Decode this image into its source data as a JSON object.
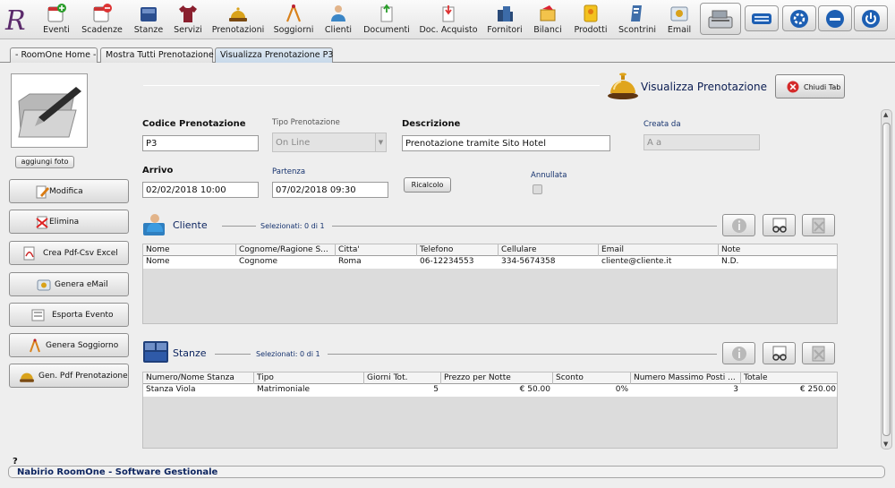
{
  "toolbar": {
    "items": [
      {
        "label": "Eventi",
        "icon": "eventi-add-icon"
      },
      {
        "label": "Scadenze",
        "icon": "scadenze-calendar-icon"
      },
      {
        "label": "Stanze",
        "icon": "stanze-bed-icon"
      },
      {
        "label": "Servizi",
        "icon": "servizi-shirt-icon"
      },
      {
        "label": "Prenotazioni",
        "icon": "prenotazioni-bell-icon"
      },
      {
        "label": "Soggiorni",
        "icon": "soggiorni-compass-icon"
      },
      {
        "label": "Clienti",
        "icon": "clienti-person-icon"
      },
      {
        "label": "Documenti",
        "icon": "documenti-icon"
      },
      {
        "label": "Doc. Acquisto",
        "icon": "doc-acquisto-icon"
      },
      {
        "label": "Fornitori",
        "icon": "fornitori-icon"
      },
      {
        "label": "Bilanci",
        "icon": "bilanci-icon"
      },
      {
        "label": "Prodotti",
        "icon": "prodotti-icon"
      },
      {
        "label": "Scontrini",
        "icon": "scontrini-icon"
      },
      {
        "label": "Email",
        "icon": "email-icon"
      }
    ]
  },
  "tabs": [
    {
      "label": "- RoomOne Home -",
      "active": false
    },
    {
      "label": "Mostra Tutti Prenotazione",
      "active": false
    },
    {
      "label": "Visualizza Prenotazione P3",
      "active": true
    }
  ],
  "left_panel": {
    "photo_button": "aggiungi foto",
    "actions": [
      {
        "label": "Modifica",
        "icon": "edit-pencil-icon"
      },
      {
        "label": "Elimina",
        "icon": "delete-icon"
      },
      {
        "label": "Crea Pdf-Csv Excel",
        "icon": "pdf-icon"
      },
      {
        "label": "Genera eMail",
        "icon": "mail-icon"
      },
      {
        "label": "Esporta Evento",
        "icon": "export-icon"
      },
      {
        "label": "Genera Soggiorno",
        "icon": "compass-icon"
      },
      {
        "label": "Gen. Pdf Prenotazione",
        "icon": "bell-icon"
      }
    ]
  },
  "header": {
    "title": "Visualizza Prenotazione",
    "close_button": "Chiudi Tab"
  },
  "form": {
    "codice_label": "Codice Prenotazione",
    "codice_value": "P3",
    "tipo_label": "Tipo Prenotazione",
    "tipo_value": "On Line",
    "descrizione_label": "Descrizione",
    "descrizione_value": "Prenotazione tramite Sito Hotel",
    "creata_label": "Creata da",
    "creata_value": "A a",
    "arrivo_label": "Arrivo",
    "arrivo_value": "02/02/2018 10:00",
    "partenza_label": "Partenza",
    "partenza_value": "07/02/2018 09:30",
    "ricalcolo_button": "Ricalcolo",
    "annullata_label": "Annullata",
    "annullata_checked": false
  },
  "cliente": {
    "title": "Cliente",
    "selected": "Selezionati:  0 di 1",
    "columns": [
      "Nome",
      "Cognome/Ragione S...",
      "Citta'",
      "Telefono",
      "Cellulare",
      "Email",
      "Note"
    ],
    "rows": [
      [
        "Nome",
        "Cognome",
        "Roma",
        "06-12234553",
        "334-5674358",
        "cliente@cliente.it",
        "N.D."
      ]
    ]
  },
  "stanze": {
    "title": "Stanze",
    "selected": "Selezionati:  0 di 1",
    "columns": [
      "Numero/Nome Stanza",
      "Tipo",
      "Giorni Tot.",
      "Prezzo per Notte",
      "Sconto",
      "Numero Massimo Posti ...",
      "Totale"
    ],
    "rows": [
      [
        "Stanza Viola",
        "Matrimoniale",
        "5",
        "€ 50.00",
        "0%",
        "3",
        "€ 250.00"
      ]
    ]
  },
  "status_bar": {
    "help": "?",
    "text": "Nabirio RoomOne - Software Gestionale"
  }
}
